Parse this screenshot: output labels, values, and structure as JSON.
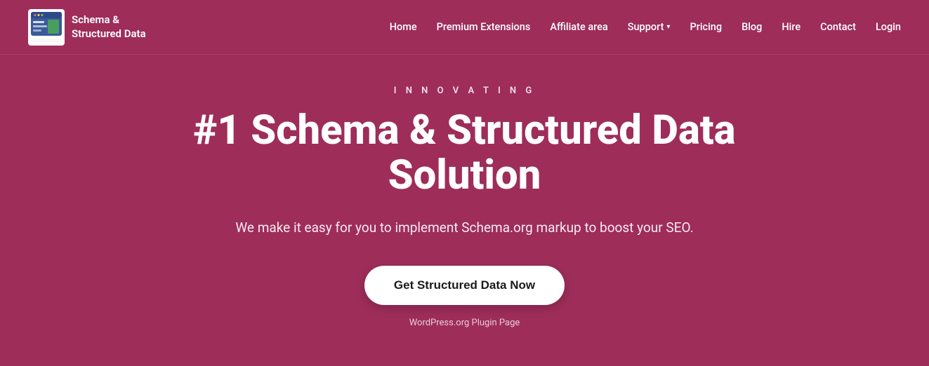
{
  "brand": {
    "logo_text_line1": "Schema &",
    "logo_text_line2": "Structured Data"
  },
  "nav": {
    "items": [
      {
        "label": "Home",
        "has_dropdown": false
      },
      {
        "label": "Premium Extensions",
        "has_dropdown": false
      },
      {
        "label": "Affiliate area",
        "has_dropdown": false
      },
      {
        "label": "Support",
        "has_dropdown": true
      },
      {
        "label": "Pricing",
        "has_dropdown": false
      },
      {
        "label": "Blog",
        "has_dropdown": false
      },
      {
        "label": "Hire",
        "has_dropdown": false
      },
      {
        "label": "Contact",
        "has_dropdown": false
      },
      {
        "label": "Login",
        "has_dropdown": false
      }
    ]
  },
  "hero": {
    "tagline": "I N N O V A T I N G",
    "title": "#1 Schema & Structured Data Solution",
    "subtitle": "We make it easy for you to implement Schema.org markup to boost your SEO.",
    "cta_button": "Get Structured Data Now",
    "footer_link": "WordPress.org Plugin Page"
  },
  "colors": {
    "background": "#9e2d5a",
    "white": "#ffffff",
    "cta_text": "#1a1a1a"
  }
}
